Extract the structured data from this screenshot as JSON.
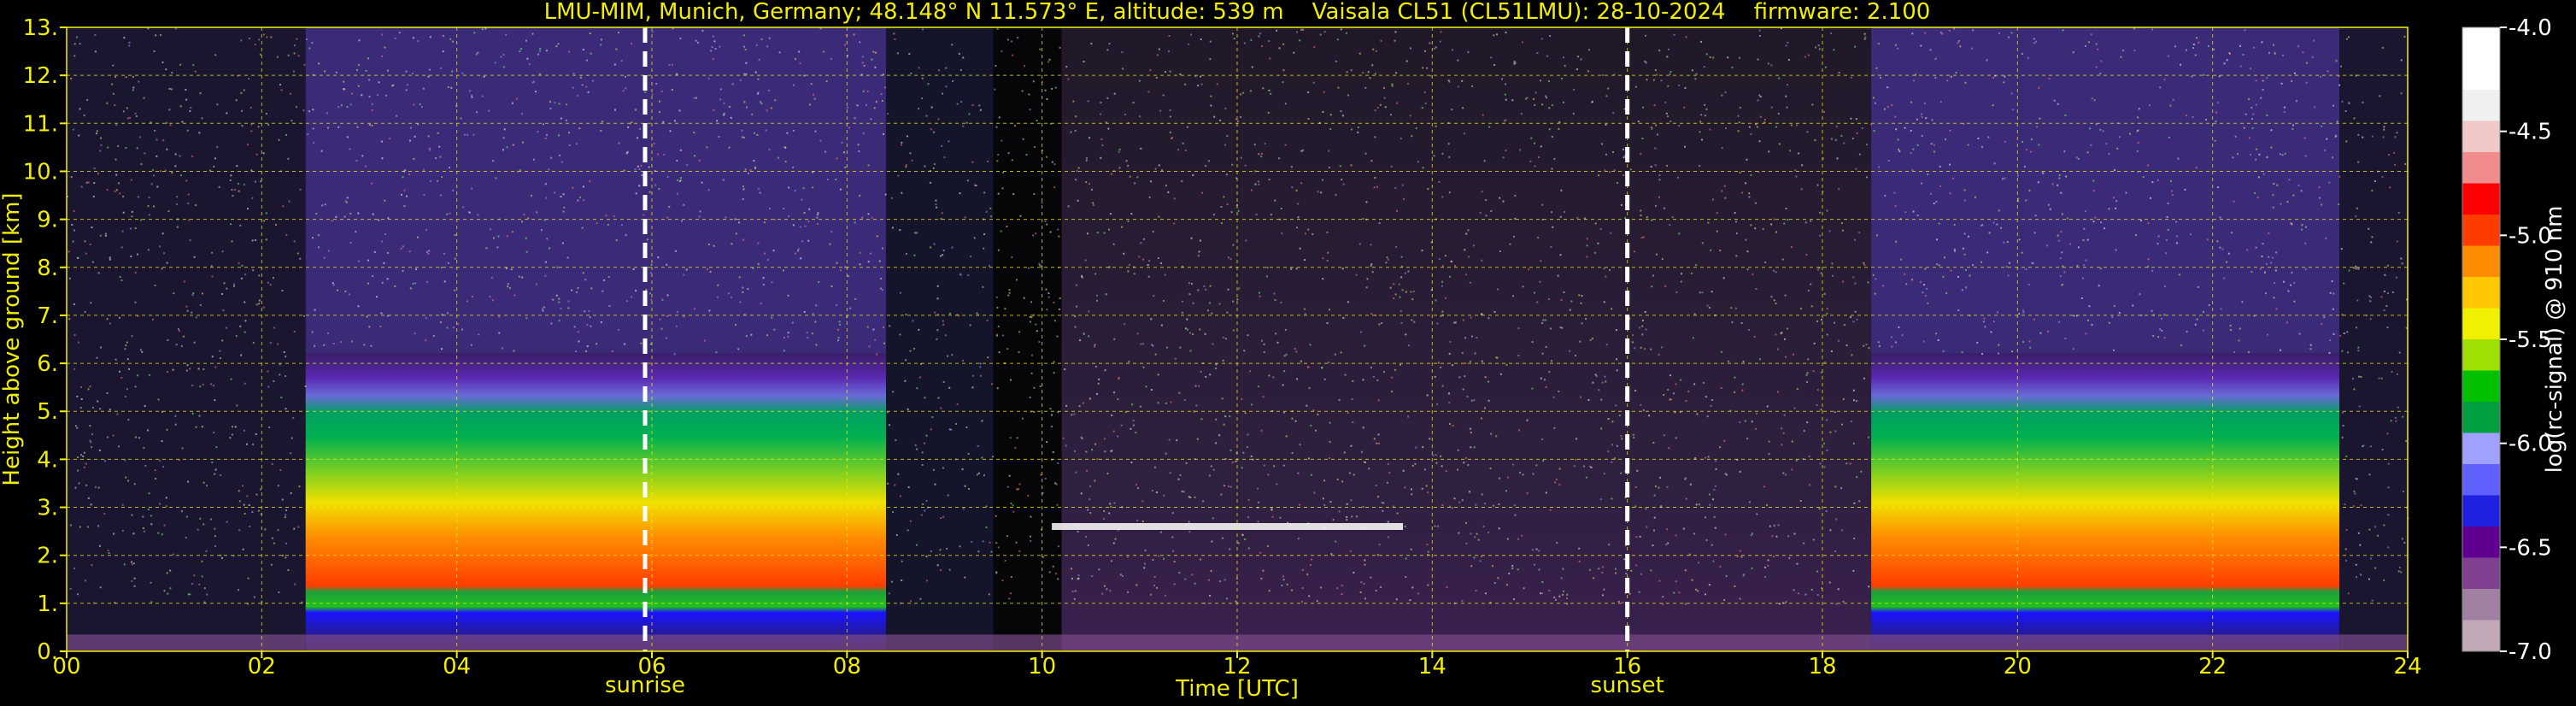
{
  "chart_data": {
    "type": "heatmap",
    "title": "LMU-MIM, Munich, Germany; 48.148° N 11.573° E, altitude: 539 m    Vaisala CL51 (CL51LMU): 28-10-2024    firmware: 2.100",
    "xlabel": "Time [UTC]",
    "ylabel": "Height above ground [km]",
    "xlim": [
      0,
      24
    ],
    "ylim": [
      0,
      13
    ],
    "x_ticks": [
      "00",
      "02",
      "04",
      "06",
      "08",
      "10",
      "12",
      "14",
      "16",
      "18",
      "20",
      "22",
      "24"
    ],
    "y_ticks": [
      "0.",
      "1.",
      "2.",
      "3.",
      "4.",
      "5.",
      "6.",
      "7.",
      "8.",
      "9.",
      "10.",
      "11.",
      "12.",
      "13."
    ],
    "grid": true,
    "markers": [
      {
        "label": "sunrise",
        "x": 5.93
      },
      {
        "label": "sunset",
        "x": 16.0
      }
    ],
    "colorbar": {
      "label": "log(rc-signal) @ 910 nm",
      "range": [
        -7.0,
        -4.0
      ],
      "ticks": [
        "-4.0",
        "-4.5",
        "-5.0",
        "-5.5",
        "-6.0",
        "-6.5",
        "-7.0"
      ],
      "colors": [
        "#ffffff",
        "#ffffff",
        "#f0f0f0",
        "#f0c8c8",
        "#f08c8c",
        "#ff0000",
        "#ff3c00",
        "#ff8c00",
        "#ffc800",
        "#f0f000",
        "#a0e000",
        "#00c000",
        "#00a040",
        "#a0a0ff",
        "#6060ff",
        "#2020e0",
        "#600090",
        "#804090",
        "#a080a0",
        "#c0a8b8"
      ]
    },
    "profiles": [
      {
        "t0": 0.0,
        "t1": 2.45,
        "kind": "night"
      },
      {
        "t0": 2.45,
        "t1": 8.4,
        "kind": "aerosol",
        "top": 6.2
      },
      {
        "t0": 8.4,
        "t1": 9.5,
        "kind": "transition"
      },
      {
        "t0": 9.5,
        "t1": 10.2,
        "kind": "dark"
      },
      {
        "t0": 10.2,
        "t1": 18.5,
        "kind": "noise"
      },
      {
        "t0": 18.5,
        "t1": 23.3,
        "kind": "aerosol",
        "top": 6.2
      },
      {
        "t0": 23.3,
        "t1": 24.0,
        "kind": "night"
      }
    ],
    "cloud_layer": {
      "t0": 10.1,
      "t1": 13.7,
      "height": 2.6
    }
  }
}
